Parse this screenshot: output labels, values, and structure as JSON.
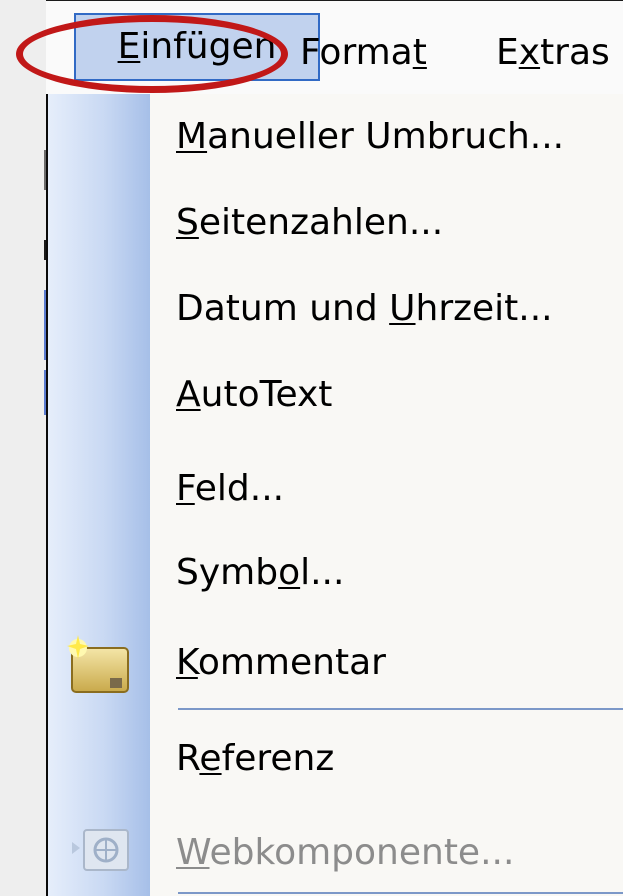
{
  "menubar": {
    "items": [
      {
        "label": "Einfügen",
        "underline": "E",
        "active": true
      },
      {
        "label": "Format",
        "underline": "t",
        "active": false
      },
      {
        "label": "Extras",
        "underline": "x",
        "active": false
      }
    ]
  },
  "menu": {
    "items": [
      {
        "label": "Manueller Umbruch...",
        "underline": "M",
        "icon": null,
        "disabled": false
      },
      {
        "label": "Seitenzahlen...",
        "underline": "S",
        "icon": null,
        "disabled": false
      },
      {
        "label": "Datum und Uhrzeit...",
        "underline": "U",
        "icon": null,
        "disabled": false
      },
      {
        "label": "AutoText",
        "underline": "A",
        "icon": null,
        "disabled": false
      },
      {
        "label": "Feld...",
        "underline": "F",
        "icon": null,
        "disabled": false
      },
      {
        "label": "Symbol...",
        "underline": "o",
        "icon": null,
        "disabled": false
      },
      {
        "label": "Kommentar",
        "underline": "K",
        "icon": "comment-icon",
        "disabled": false
      },
      {
        "label": "Referenz",
        "underline": "e",
        "icon": null,
        "disabled": false
      },
      {
        "label": "Webkomponente...",
        "underline": "W",
        "icon": "web-component-icon",
        "disabled": true
      }
    ]
  },
  "colors": {
    "highlight_ring": "#c11818",
    "active_menu_bg": "#c1d2ee",
    "active_menu_border": "#316ac5",
    "gutter": "#a6bfe8",
    "separator": "#7c98c8",
    "disabled_text": "#8c8c8c"
  }
}
